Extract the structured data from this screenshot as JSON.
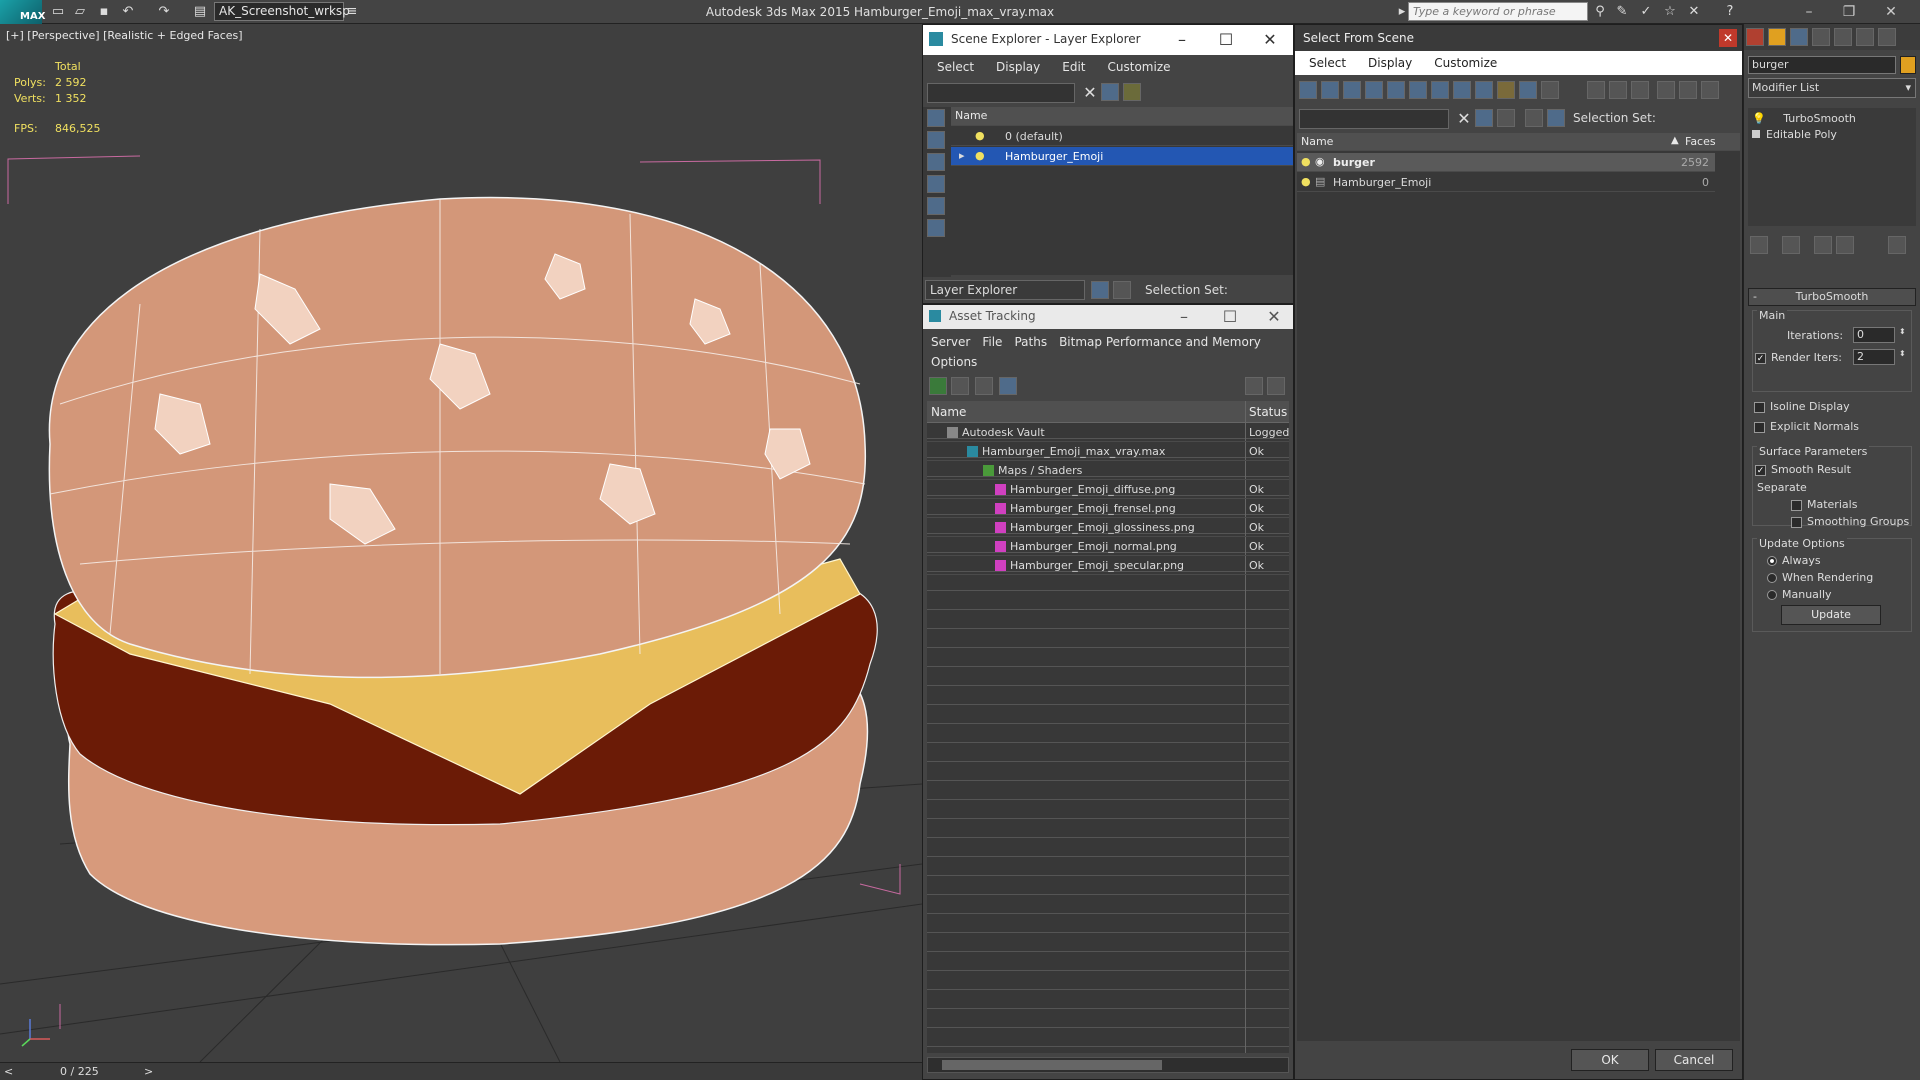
{
  "titlebar": {
    "app": "MAX",
    "workspace": "AK_Screenshot_wrksp",
    "title": "Autodesk 3ds Max 2015    Hamburger_Emoji_max_vray.max",
    "search_placeholder": "Type a keyword or phrase"
  },
  "viewport": {
    "label": "[+] [Perspective] [Realistic + Edged Faces]",
    "stats_header": "Total",
    "polys_label": "Polys:",
    "polys": "2 592",
    "verts_label": "Verts:",
    "verts": "1 352",
    "fps_label": "FPS:",
    "fps": "846,525",
    "timeline": "0 / 225"
  },
  "scene_explorer": {
    "title": "Scene Explorer - Layer Explorer",
    "menu": [
      "Select",
      "Display",
      "Edit",
      "Customize"
    ],
    "col_name": "Name",
    "rows": [
      "0 (default)",
      "Hamburger_Emoji"
    ],
    "footer_label": "Layer Explorer",
    "selection_set": "Selection Set:"
  },
  "asset_tracking": {
    "title": "Asset Tracking",
    "menu": [
      "Server",
      "File",
      "Paths",
      "Bitmap Performance and Memory"
    ],
    "menu2": "Options",
    "col_name": "Name",
    "col_status": "Status",
    "rows": [
      {
        "name": "Autodesk Vault",
        "status": "Logged"
      },
      {
        "name": "Hamburger_Emoji_max_vray.max",
        "status": "Ok"
      },
      {
        "name": "Maps / Shaders",
        "status": ""
      },
      {
        "name": "Hamburger_Emoji_diffuse.png",
        "status": "Ok"
      },
      {
        "name": "Hamburger_Emoji_frensel.png",
        "status": "Ok"
      },
      {
        "name": "Hamburger_Emoji_glossiness.png",
        "status": "Ok"
      },
      {
        "name": "Hamburger_Emoji_normal.png",
        "status": "Ok"
      },
      {
        "name": "Hamburger_Emoji_specular.png",
        "status": "Ok"
      }
    ]
  },
  "select_from_scene": {
    "title": "Select From Scene",
    "menu": [
      "Select",
      "Display",
      "Customize"
    ],
    "selection_set": "Selection Set:",
    "col_name": "Name",
    "col_faces": "Faces",
    "rows": [
      {
        "name": "burger",
        "faces": "2592"
      },
      {
        "name": "Hamburger_Emoji",
        "faces": "0"
      }
    ],
    "ok": "OK",
    "cancel": "Cancel"
  },
  "command_panel": {
    "search_value": "burger",
    "modifier_list": "Modifier List",
    "stack": [
      "TurboSmooth",
      "Editable Poly"
    ],
    "rollout": "TurboSmooth",
    "main": "Main",
    "iterations_label": "Iterations:",
    "iterations": "0",
    "render_iters_label": "Render Iters:",
    "render_iters": "2",
    "isoline": "Isoline Display",
    "explicit_normals": "Explicit Normals",
    "surface_params": "Surface Parameters",
    "smooth_result": "Smooth Result",
    "separate": "Separate",
    "materials": "Materials",
    "smoothing_groups": "Smoothing Groups",
    "update_options": "Update Options",
    "always": "Always",
    "when_rendering": "When Rendering",
    "manually": "Manually",
    "update_btn": "Update"
  }
}
